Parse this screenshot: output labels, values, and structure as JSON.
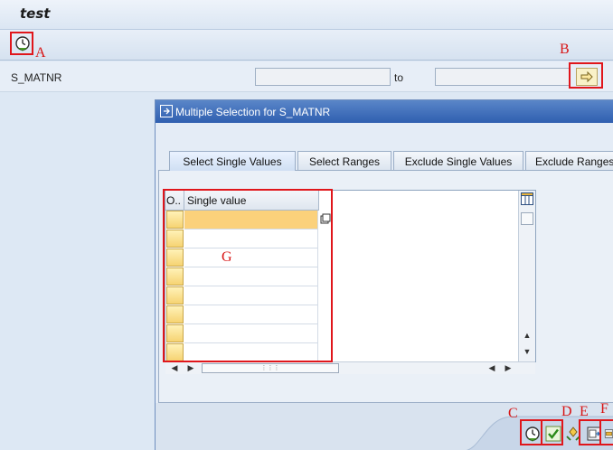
{
  "window": {
    "title": "test"
  },
  "toolbar": {
    "execute_icon": "execute-clock-icon"
  },
  "selection": {
    "field_label": "S_MATNR",
    "low_value": "",
    "high_value": "",
    "to_label": "to"
  },
  "dialog": {
    "title": "Multiple Selection for S_MATNR",
    "tabs": [
      {
        "label": "Select Single Values",
        "active": true
      },
      {
        "label": "Select Ranges",
        "active": false
      },
      {
        "label": "Exclude Single Values",
        "active": false
      },
      {
        "label": "Exclude Ranges",
        "active": false
      }
    ],
    "table": {
      "columns": [
        "O..",
        "Single value"
      ],
      "row_count": 8
    }
  },
  "annotations": {
    "A": "A",
    "B": "B",
    "C": "C",
    "D": "D",
    "E": "E",
    "F": "F",
    "G": "G"
  },
  "colors": {
    "annotation_red": "#e0161b",
    "dialog_title_blue": "#2f5fb0",
    "selected_cell": "#fbd17b"
  }
}
